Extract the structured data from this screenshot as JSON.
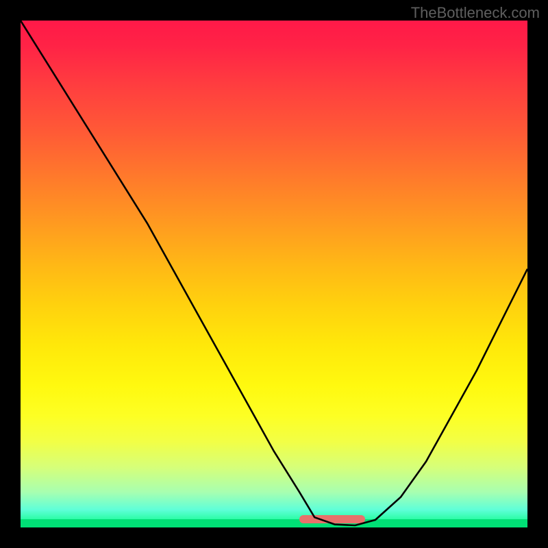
{
  "watermark": "TheBottleneck.com",
  "colors": {
    "background": "#000000",
    "watermark_text": "#5f5f5f",
    "curve": "#000000",
    "salmon": "#e8716b",
    "green_floor": "#00e076"
  },
  "chart_data": {
    "type": "line",
    "title": "",
    "xlabel": "",
    "ylabel": "",
    "xlim": [
      0,
      100
    ],
    "ylim": [
      0,
      100
    ],
    "series": [
      {
        "name": "bottleneck-curve",
        "x": [
          0,
          5,
          10,
          15,
          20,
          25,
          30,
          35,
          40,
          45,
          50,
          55,
          58,
          62,
          66,
          70,
          75,
          80,
          85,
          90,
          95,
          100
        ],
        "values": [
          100,
          92,
          84,
          76,
          68,
          60,
          51,
          42,
          33,
          24,
          15,
          7,
          2,
          0.6,
          0.4,
          1.5,
          6,
          13,
          22,
          31,
          41,
          51
        ]
      }
    ],
    "salmon_band": {
      "x_start": 55,
      "x_end": 68,
      "y": 0.7
    },
    "gradient_stops": [
      {
        "pct": 0,
        "color": "#ff1948"
      },
      {
        "pct": 22,
        "color": "#ff5a36"
      },
      {
        "pct": 48,
        "color": "#ffb716"
      },
      {
        "pct": 72,
        "color": "#fff90f"
      },
      {
        "pct": 88,
        "color": "#d7ff78"
      },
      {
        "pct": 100,
        "color": "#00fa7a"
      }
    ]
  }
}
